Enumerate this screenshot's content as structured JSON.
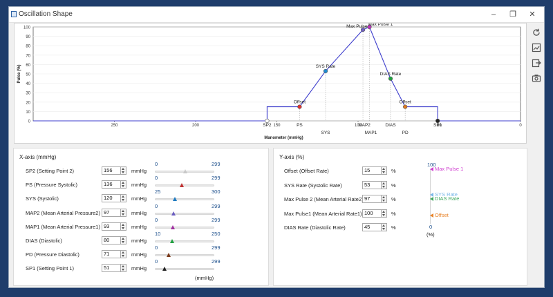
{
  "window": {
    "title": "Oscillation Shape",
    "controls": [
      "–",
      "❐",
      "✕"
    ]
  },
  "chart_data": {
    "type": "line",
    "xlabel": "Manometer (mmHg)",
    "ylabel": "Pulse (%)",
    "xlim": [
      300,
      0
    ],
    "ylim": [
      0,
      100
    ],
    "x_ticks": [
      "250",
      "200",
      "150",
      "100",
      "50",
      "0"
    ],
    "y_ticks": [
      "0",
      "10",
      "20",
      "30",
      "40",
      "50",
      "60",
      "70",
      "80",
      "90",
      "100"
    ],
    "grid": true,
    "points": [
      {
        "label": "SP2",
        "x": 156,
        "y": 0,
        "color": "#ffffff"
      },
      {
        "label": "Offset",
        "x": 136,
        "y": 15,
        "color": "#e03030"
      },
      {
        "label": "SYS Rate",
        "x": 120,
        "y": 53,
        "color": "#1e8ad0"
      },
      {
        "label": "Max Pulse 2",
        "x": 97,
        "y": 97,
        "color": "#7060c0"
      },
      {
        "label": "Max Pulse 1",
        "x": 93,
        "y": 100,
        "color": "#c030c0"
      },
      {
        "label": "DIAS Rate",
        "x": 80,
        "y": 45,
        "color": "#20a040"
      },
      {
        "label": "Offset",
        "x": 71,
        "y": 15,
        "color": "#e07a20"
      },
      {
        "label": "SP1",
        "x": 51,
        "y": 0,
        "color": "#222222"
      }
    ],
    "line": [
      [
        300,
        0
      ],
      [
        156,
        0
      ],
      [
        156,
        15
      ],
      [
        136,
        15
      ],
      [
        120,
        53
      ],
      [
        97,
        97
      ],
      [
        93,
        100
      ],
      [
        80,
        45
      ],
      [
        71,
        15
      ],
      [
        51,
        15
      ],
      [
        51,
        0
      ],
      [
        0,
        0
      ]
    ],
    "x_marker_labels": [
      {
        "label": "SP2",
        "x": 156
      },
      {
        "label": "PS",
        "x": 136
      },
      {
        "label": "SYS",
        "x": 120
      },
      {
        "label": "MAP2",
        "x": 97
      },
      {
        "label": "MAP1",
        "x": 93
      },
      {
        "label": "DIAS",
        "x": 80
      },
      {
        "label": "PD",
        "x": 71
      },
      {
        "label": "SP1",
        "x": 51
      }
    ]
  },
  "xaxis": {
    "title": "X-axis (mmHg)",
    "unit": "mmHg",
    "footer": "(mmHg)",
    "rows": [
      {
        "label": "SP2 (Setting Point 2)",
        "value": "156",
        "min": "0",
        "max": "299",
        "min_n": 0,
        "max_n": 299,
        "val_n": 156,
        "color": "#c8c8c8"
      },
      {
        "label": "PS (Pressure Systolic)",
        "value": "136",
        "min": "0",
        "max": "299",
        "min_n": 0,
        "max_n": 299,
        "val_n": 136,
        "color": "#c03030"
      },
      {
        "label": "SYS (Systolic)",
        "value": "120",
        "min": "25",
        "max": "300",
        "min_n": 25,
        "max_n": 300,
        "val_n": 120,
        "color": "#1e7ac0"
      },
      {
        "label": "MAP2 (Mean Arterial Pressure2)",
        "value": "97",
        "min": "0",
        "max": "299",
        "min_n": 0,
        "max_n": 299,
        "val_n": 97,
        "color": "#6a5cc0"
      },
      {
        "label": "MAP1 (Mean Arterial Pressure1)",
        "value": "93",
        "min": "0",
        "max": "299",
        "min_n": 0,
        "max_n": 299,
        "val_n": 93,
        "color": "#a030a0"
      },
      {
        "label": "DIAS (Diastolic)",
        "value": "80",
        "min": "10",
        "max": "250",
        "min_n": 10,
        "max_n": 250,
        "val_n": 80,
        "color": "#20a040"
      },
      {
        "label": "PD (Pressure Diastolic)",
        "value": "71",
        "min": "0",
        "max": "299",
        "min_n": 0,
        "max_n": 299,
        "val_n": 71,
        "color": "#7a3a1a"
      },
      {
        "label": "SP1 (Setting Point 1)",
        "value": "51",
        "min": "0",
        "max": "299",
        "min_n": 0,
        "max_n": 299,
        "val_n": 51,
        "color": "#222222"
      }
    ]
  },
  "yaxis": {
    "title": "Y-axis (%)",
    "unit": "%",
    "rows": [
      {
        "label": "Offset (Offset Rate)",
        "value": "15"
      },
      {
        "label": "SYS Rate (Systolic Rate)",
        "value": "53"
      },
      {
        "label": "Max Pulse 2 (Mean Arterial Rate2)",
        "value": "97"
      },
      {
        "label": "Max Pulse1 (Mean Arterial Rate1)",
        "value": "100"
      },
      {
        "label": "DIAS Rate (Diastolic Rate)",
        "value": "45"
      }
    ],
    "scale_top": "100",
    "scale_bottom": "0",
    "scale_unit": "(%)",
    "markers": [
      {
        "label": "Max Pulse 1",
        "value": 100,
        "color": "#d040d0"
      },
      {
        "label": "SYS Rate",
        "value": 53,
        "color": "#7ab8e8"
      },
      {
        "label": "DIAS Rate",
        "value": 45,
        "color": "#40a860"
      },
      {
        "label": "Offset",
        "value": 15,
        "color": "#e8842a"
      }
    ]
  }
}
